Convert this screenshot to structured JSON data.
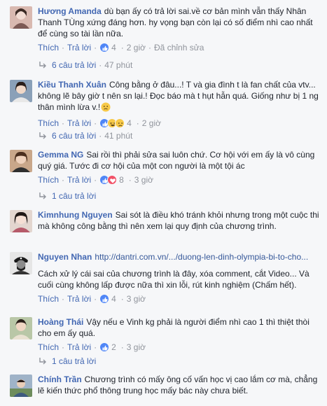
{
  "comments": [
    {
      "name": "Hương Amanda",
      "text": "dù bạn ấy có trả lời sai.về cơ bản mình vẫn thấy Nhân Thanh TÙng xứng đáng hơn. hy vọng bạn còn lại có số điểm nhì cao nhất để cùng so tài lần nữa.",
      "like": "Thích",
      "reply": "Trả lời",
      "count": "4",
      "time": "2 giờ",
      "edited": "Đã chỉnh sửa"
    },
    {
      "name": "Kiều Thanh Xuân",
      "text": "Công bằng ở đâu...! T và gia đình t là fan chất của vtv... không lẽ bây giờ t nên sn lại.! Đọc báo mà t hụt hẫn quá. Giống như bị 1 ng thân mình lừa v.!",
      "emoji_icon": "sad-face-icon",
      "like": "Thích",
      "reply": "Trả lời",
      "count": "4",
      "time": "2 giờ"
    },
    {
      "name": "Gemma NG",
      "text": "Sai rồi thì phải sửa sai luôn chứ. Cơ hội với em ấy là vô cùng quý giá. Tước đi cơ hội của một con người là một tội ác",
      "like": "Thích",
      "reply": "Trả lời",
      "count": "8",
      "time": "3 giờ"
    },
    {
      "name": "Kimnhung Nguyen",
      "text": "Sai sót là điều khó tránh khỏi nhưng trong một cuộc thi mà không công bằng thì nên xem lại quy định của chương trình.",
      "like": "Thích",
      "reply": "Trả lời",
      "count": "4",
      "time": "3 giờ"
    },
    {
      "name": "Nguyen Nhan",
      "link": "http://dantri.com.vn/.../duong-len-dinh-olympia-bi-to-cho...",
      "text": "Cách xử lý cái sai của chương trình là đây, xóa comment, cắt Video... Và cuối cùng không lấp được nữa thì xin lỗi, rút kinh nghiệm (Chấm hết).",
      "like": "Thích",
      "reply": "Trả lời",
      "count": "4",
      "time": "3 giờ"
    },
    {
      "name": "Hoàng Thái",
      "text": "Vậy nếu e Vinh kg phải là người điểm nhì cao 1 thì thiệt thòi cho em ấy quá.",
      "like": "Thích",
      "reply": "Trả lời",
      "count": "2",
      "time": "3 giờ"
    },
    {
      "name": "Chính Trần",
      "text": "Chương trình có mấy ông cố vấn học vị cao lắm cơ mà, chẳng lẽ kiến thức phổ thông trung học mấy bác này chưa biết."
    }
  ],
  "reply_links": [
    {
      "label": "6 câu trả lời",
      "time": "47 phút"
    },
    {
      "label": "6 câu trả lời",
      "time": "41 phút"
    },
    {
      "label": "1 câu trả lời"
    },
    {
      "label": "1 câu trả lời"
    }
  ],
  "separator": "·",
  "colors": {
    "name": "#4267b2",
    "meta": "#90949c",
    "background": "#f6f7f9",
    "like": "#4f86f7"
  }
}
